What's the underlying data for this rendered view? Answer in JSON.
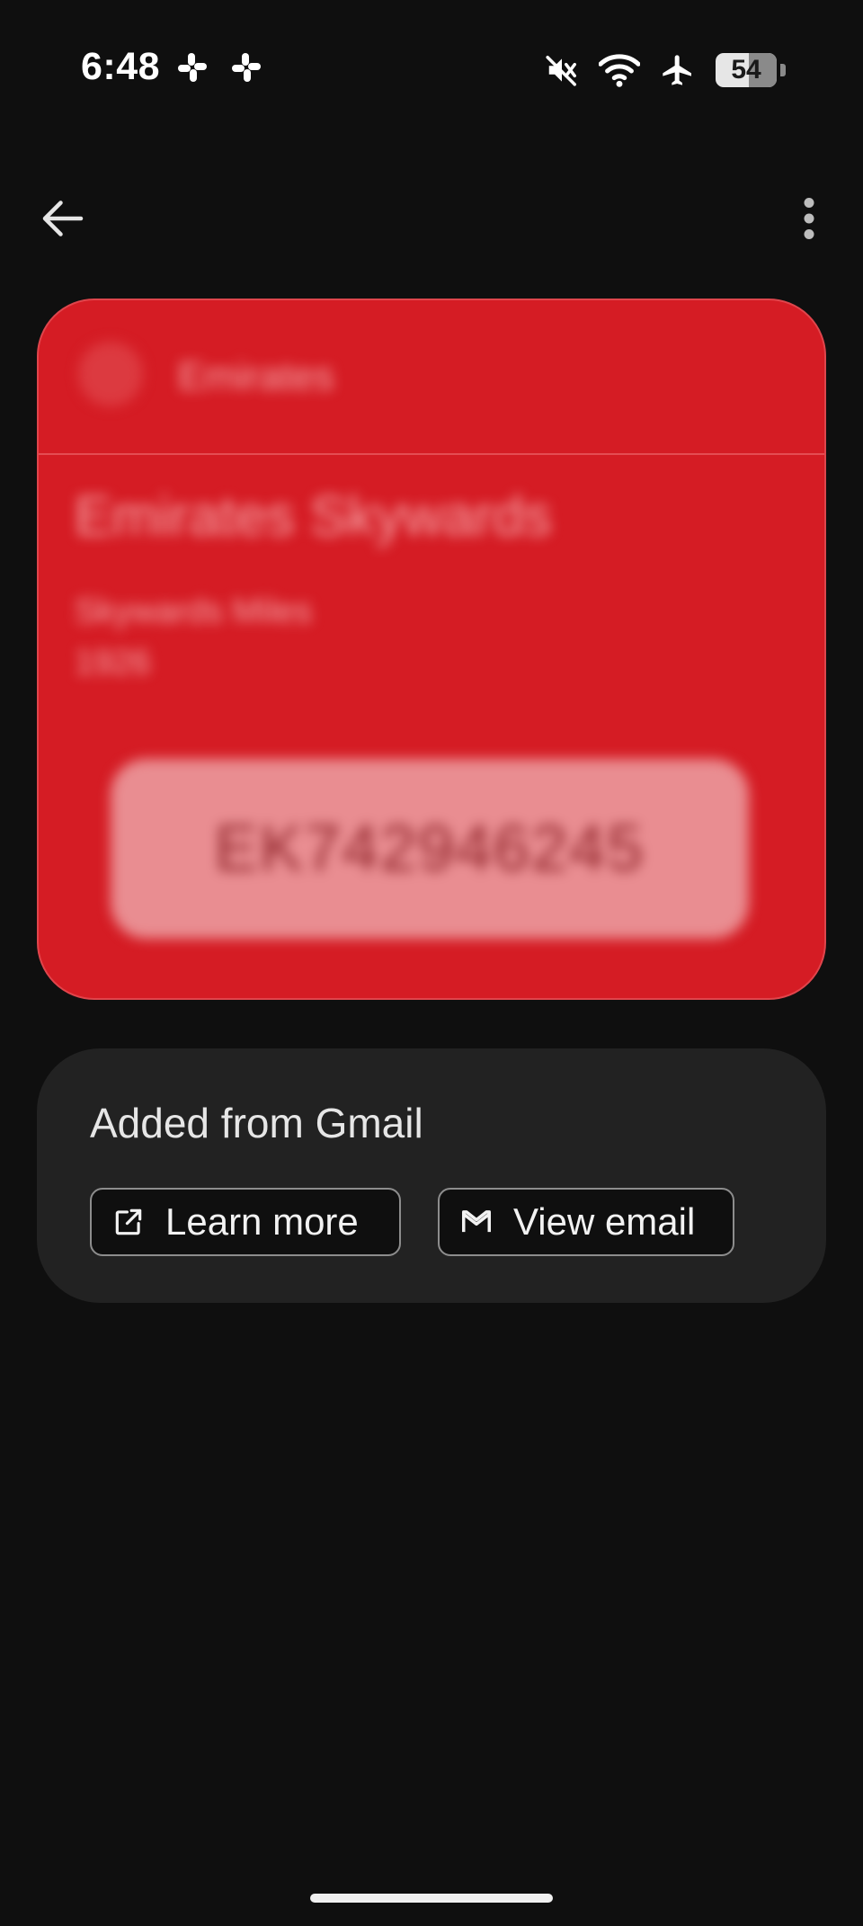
{
  "status_bar": {
    "time": "6:48",
    "notification_icons": [
      "slack-icon",
      "slack-icon"
    ],
    "system_icons": [
      "mute-icon",
      "wifi-icon",
      "airplane-mode-icon",
      "battery-icon"
    ],
    "battery_percent": "54",
    "battery_level": 0.54
  },
  "toolbar": {
    "back_icon": "arrow-back-icon",
    "more_icon": "more-vertical-icon"
  },
  "pass_card": {
    "color": "#d51c24",
    "issuer": "Emirates",
    "program_name": "Emirates Skywards",
    "field_label": "Skywards Miles",
    "field_value": "1926",
    "barcode_value": "EK742946245"
  },
  "info": {
    "title": "Added from Gmail",
    "learn_more_label": "Learn more",
    "learn_more_icon": "open-in-new-icon",
    "view_email_label": "View email",
    "view_email_icon": "gmail-icon"
  }
}
